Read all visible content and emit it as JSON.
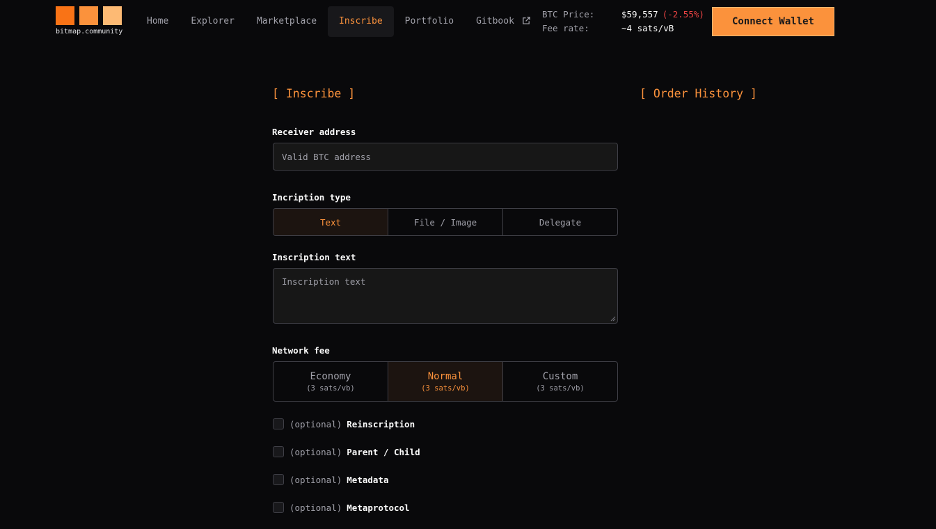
{
  "brand": {
    "name": "bitmap.community"
  },
  "nav": {
    "items": [
      {
        "label": "Home"
      },
      {
        "label": "Explorer"
      },
      {
        "label": "Marketplace"
      },
      {
        "label": "Inscribe"
      },
      {
        "label": "Portfolio"
      },
      {
        "label": "Gitbook"
      }
    ],
    "active": "Inscribe",
    "external_icon": "external-link-icon"
  },
  "stats": {
    "btc_price_label": "BTC Price:",
    "btc_price_value": "$59,557",
    "btc_price_change": "(-2.55%)",
    "fee_rate_label": "Fee rate:",
    "fee_rate_value": "~4 sats/vB"
  },
  "connect_button": "Connect Wallet",
  "colors": {
    "accent": "#fb923c",
    "negative": "#ef4444",
    "background": "#09090b"
  },
  "inscribe": {
    "title": "[ Inscribe ]",
    "receiver": {
      "label": "Receiver address",
      "placeholder": "Valid BTC address"
    },
    "type": {
      "label": "Incription type",
      "options": [
        "Text",
        "File / Image",
        "Delegate"
      ],
      "selected": "Text"
    },
    "text": {
      "label": "Inscription text",
      "placeholder": "Inscription text"
    },
    "fee": {
      "label": "Network fee",
      "options": [
        {
          "name": "Economy",
          "rate": "(3 sats/vb)"
        },
        {
          "name": "Normal",
          "rate": "(3 sats/vb)"
        },
        {
          "name": "Custom",
          "rate": "(3 sats/vb)"
        }
      ],
      "selected": "Normal"
    },
    "optionals": {
      "tag": "(optional)",
      "items": [
        "Reinscription",
        "Parent / Child",
        "Metadata",
        "Metaprotocol"
      ]
    }
  },
  "order_history": {
    "title": "[ Order History ]"
  }
}
